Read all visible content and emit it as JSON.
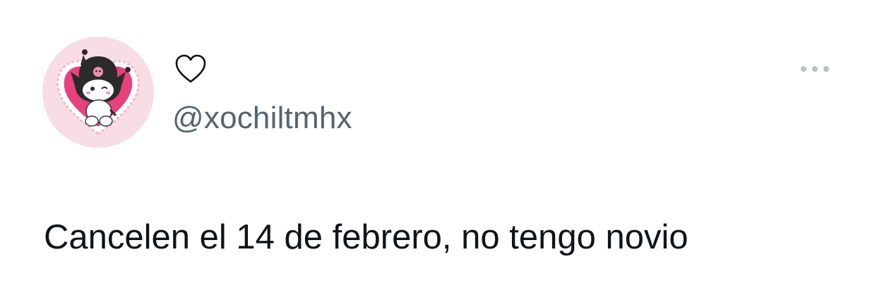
{
  "tweet": {
    "avatar_icon": "kuromi-heart-avatar",
    "display_name_icon": "heart-outline-icon",
    "handle": "@xochiltmhx",
    "more_icon": "more-options-icon",
    "text": "Cancelen el 14 de febrero, no tengo novio"
  },
  "colors": {
    "text_primary": "#0f1419",
    "text_secondary": "#536471",
    "avatar_bg": "#f9dde4",
    "heart_pink": "#e8417e",
    "icon_gray": "#b9c1c8"
  }
}
